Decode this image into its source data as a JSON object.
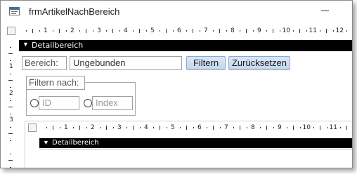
{
  "window": {
    "title": "frmArtikelNachBereich"
  },
  "ruler": {
    "marks": [
      "1",
      "2",
      "3",
      "4",
      "5",
      "6",
      "7",
      "8",
      "9",
      "10",
      "11",
      "12"
    ],
    "sub_marks": [
      "1",
      "2",
      "3",
      "4",
      "5",
      "6",
      "7",
      "8",
      "9",
      "10",
      "11"
    ],
    "side_marks": [
      "1",
      "2",
      "3"
    ]
  },
  "detail_section": {
    "label": "Detailbereich"
  },
  "filter": {
    "bereich_label": "Bereich:",
    "bereich_value": "Ungebunden",
    "filter_button": "Filtern",
    "reset_button": "Zurücksetzen",
    "group_label": "Filtern nach:",
    "option_id": "ID",
    "option_index": "Index"
  },
  "subform": {
    "section_label": "Detailbereich"
  }
}
